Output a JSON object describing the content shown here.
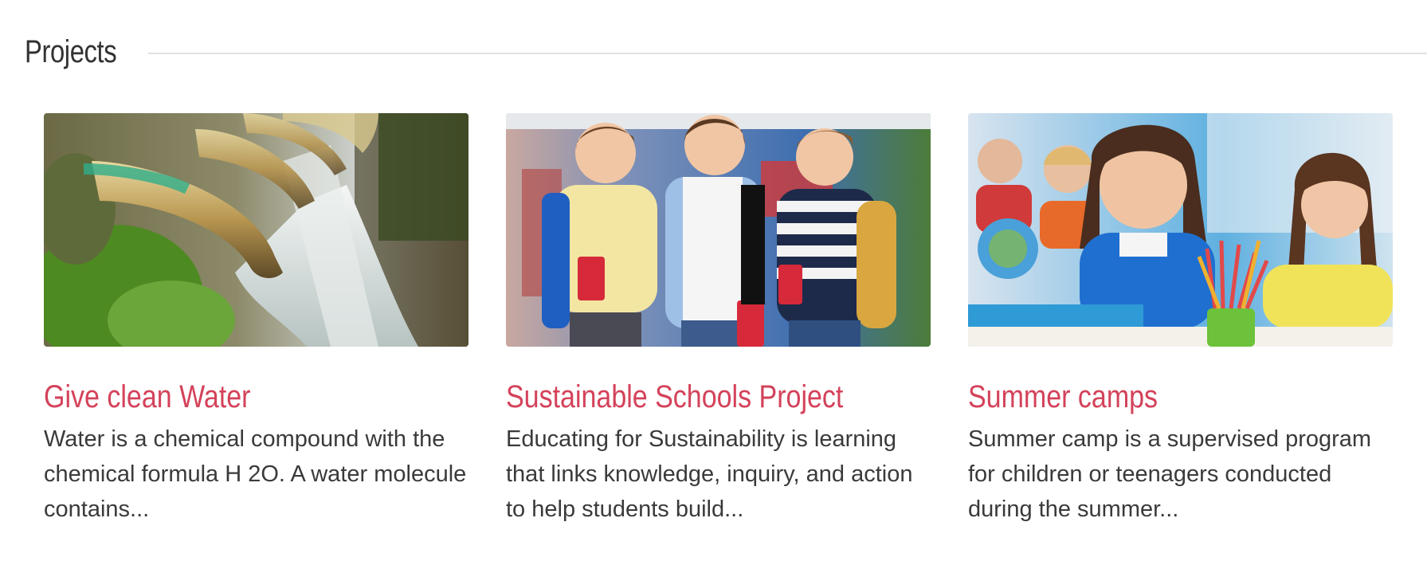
{
  "section": {
    "title": "Projects"
  },
  "projects": [
    {
      "title": "Give clean Water",
      "excerpt": "Water is a chemical compound with the chemical formula H 2O. A water molecule contains...",
      "image_icon": "water-fountain-photo"
    },
    {
      "title": "Sustainable Schools Project",
      "excerpt": "Educating for Sustainability is learning that links knowledge, inquiry, and action to help students build...",
      "image_icon": "schoolboys-photo"
    },
    {
      "title": "Summer camps",
      "excerpt": "Summer camp is a supervised program for children or teenagers conducted during the summer...",
      "image_icon": "classroom-girls-photo"
    }
  ],
  "colors": {
    "accent": "#d4425a",
    "text": "#3a3a3a",
    "rule": "#e2e2e2"
  }
}
